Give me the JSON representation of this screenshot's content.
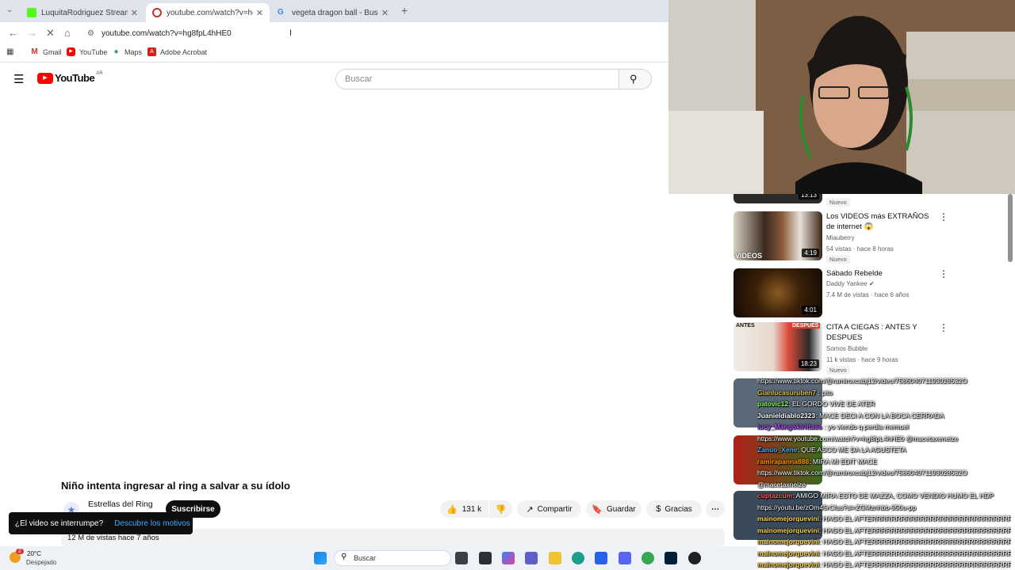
{
  "browser": {
    "tabs": [
      {
        "title": "LuquitaRodriguez Stream - Wa",
        "active": false
      },
      {
        "title": "youtube.com/watch?v=hg8fpL4",
        "active": true
      },
      {
        "title": "vegeta dragon ball - Buscar co",
        "active": false
      }
    ],
    "url": "youtube.com/watch?v=hg8fpL4hHE0",
    "bookmarks": [
      "Gmail",
      "YouTube",
      "Maps",
      "Adobe Acrobat"
    ]
  },
  "youtube": {
    "logo_text": "YouTube",
    "region": "AR",
    "search_placeholder": "Buscar",
    "video": {
      "title": "Niño intenta ingresar al ring a salvar a su ídolo",
      "channel": "Estrellas del Ring",
      "subscribe_label": "Suscribirse",
      "likes": "131 k",
      "share_label": "Compartir",
      "save_label": "Guardar",
      "thanks_label": "Gracias",
      "views": "12 M de vistas  hace 7 años"
    },
    "toast": {
      "question": "¿El video se interrumpe?",
      "link": "Descubre los motivos"
    },
    "recommendations": [
      {
        "title": "",
        "duration": "13:13",
        "channel": "",
        "meta": "",
        "badge": "Nuevo"
      },
      {
        "title": "Los VIDEOS más EXTRAÑOS de internet 😱",
        "duration": "4:19",
        "channel": "Miauberry",
        "meta": "54 vistas · hace 8 horas",
        "badge": "Nuevo"
      },
      {
        "title": "Sábado Rebelde",
        "duration": "4:01",
        "channel": "Daddy Yankee ✔",
        "meta": "7.4 M de vistas · hace 6 años",
        "badge": ""
      },
      {
        "title": "CITA A CIEGAS : ANTES Y DESPUES",
        "duration": "18:23",
        "channel": "Somos Bubble",
        "meta": "11 k vistas · hace 9 horas",
        "badge": "Nuevo",
        "thumb_labels": [
          "ANTES",
          "DESPUES"
        ]
      }
    ]
  },
  "chat": [
    {
      "user": "",
      "text": "https://www.tiktok.com/@ramiroxcabj12/video/758604071193028532O",
      "color": "#ffffff"
    },
    {
      "user": "Gianlucasuruben7",
      "text": " : pito",
      "color": "#e0c040"
    },
    {
      "user": "patovic12",
      "text": ": EL GORDO VIVE DE ATER",
      "color": "#7cff4c"
    },
    {
      "user": "Juanieldiablo2323",
      "text": ": MACE DECI A CON LA BOCA CERRADA",
      "color": "#ffffff"
    },
    {
      "user": "lucy_Mangokirittass",
      "text": " : yo viendo q perdia memuel",
      "color": "#b050ff"
    },
    {
      "user": "",
      "text": "https://www.youtube.com/watch?v=hg8fpL4hHE0 @macetaxeneize",
      "color": "#ffffff"
    },
    {
      "user": "Zanuo_Xene",
      "text": ": QUE ASCO ME DA LA AGUSTETA",
      "color": "#4aa8ff"
    },
    {
      "user": "ramirapanna888",
      "text": ": MIRA MI EDIT MACE",
      "color": "#ff9900"
    },
    {
      "user": "",
      "text": "https://www.tiktok.com/@ramiroxcabj12/video/758604071193028532O",
      "color": "#ffffff"
    },
    {
      "user": "",
      "text": "@macetaxneize",
      "color": "#ffffff"
    },
    {
      "user": "cuptazcum",
      "text": ": AMIGO MIRA ESTO DE MAZZA, COMO VENDIO HUMO EL HDP",
      "color": "#ff5a5a"
    },
    {
      "user": "",
      "text": "https://youtu.be/zOm45rCfus?si=ZGMznhbb-950u-pp",
      "color": "#ffffff"
    },
    {
      "user": "mainomejorquevini",
      "text": ": HAGO EL AFTERRRRRRRRRRRRRRRRRRRRRRRRRRRRRR",
      "color": "#ffd84a"
    },
    {
      "user": "mainomejorquevini",
      "text": ": HAGO EL AFTERRRRRRRRRRRRRRRRRRRRRRRRRRRRRR",
      "color": "#ffd84a"
    },
    {
      "user": "mainomejorquevini",
      "text": ": HAGO EL AFTERRRRRRRRRRRRRRRRRRRRRRRRRRRRRR",
      "color": "#ffd84a"
    },
    {
      "user": "mainomejorquevini",
      "text": ": HAGO EL AFTERRRRRRRRRRRRRRRRRRRRRRRRRRRRRR",
      "color": "#ffd84a"
    },
    {
      "user": "mainomejorquevini",
      "text": ": HAGO EL AFTERRRRRRRRRRRRRRRRRRRRRRRRRRRRRR",
      "color": "#ffd84a"
    },
    {
      "user": "mainomejorquevini",
      "text": ": HAGO EL AFTERRRRRRRRRRRRRRRRRRRRRRRRRRRRRR",
      "color": "#ffd84a"
    }
  ],
  "taskbar": {
    "weather_temp": "20°C",
    "weather_desc": "Despejado",
    "notification_count": "2",
    "search_placeholder": "Buscar"
  },
  "colors": {
    "youtube_red": "#ff0000",
    "tabbar": "#dfe3eb",
    "link_blue": "#3ea6ff"
  }
}
